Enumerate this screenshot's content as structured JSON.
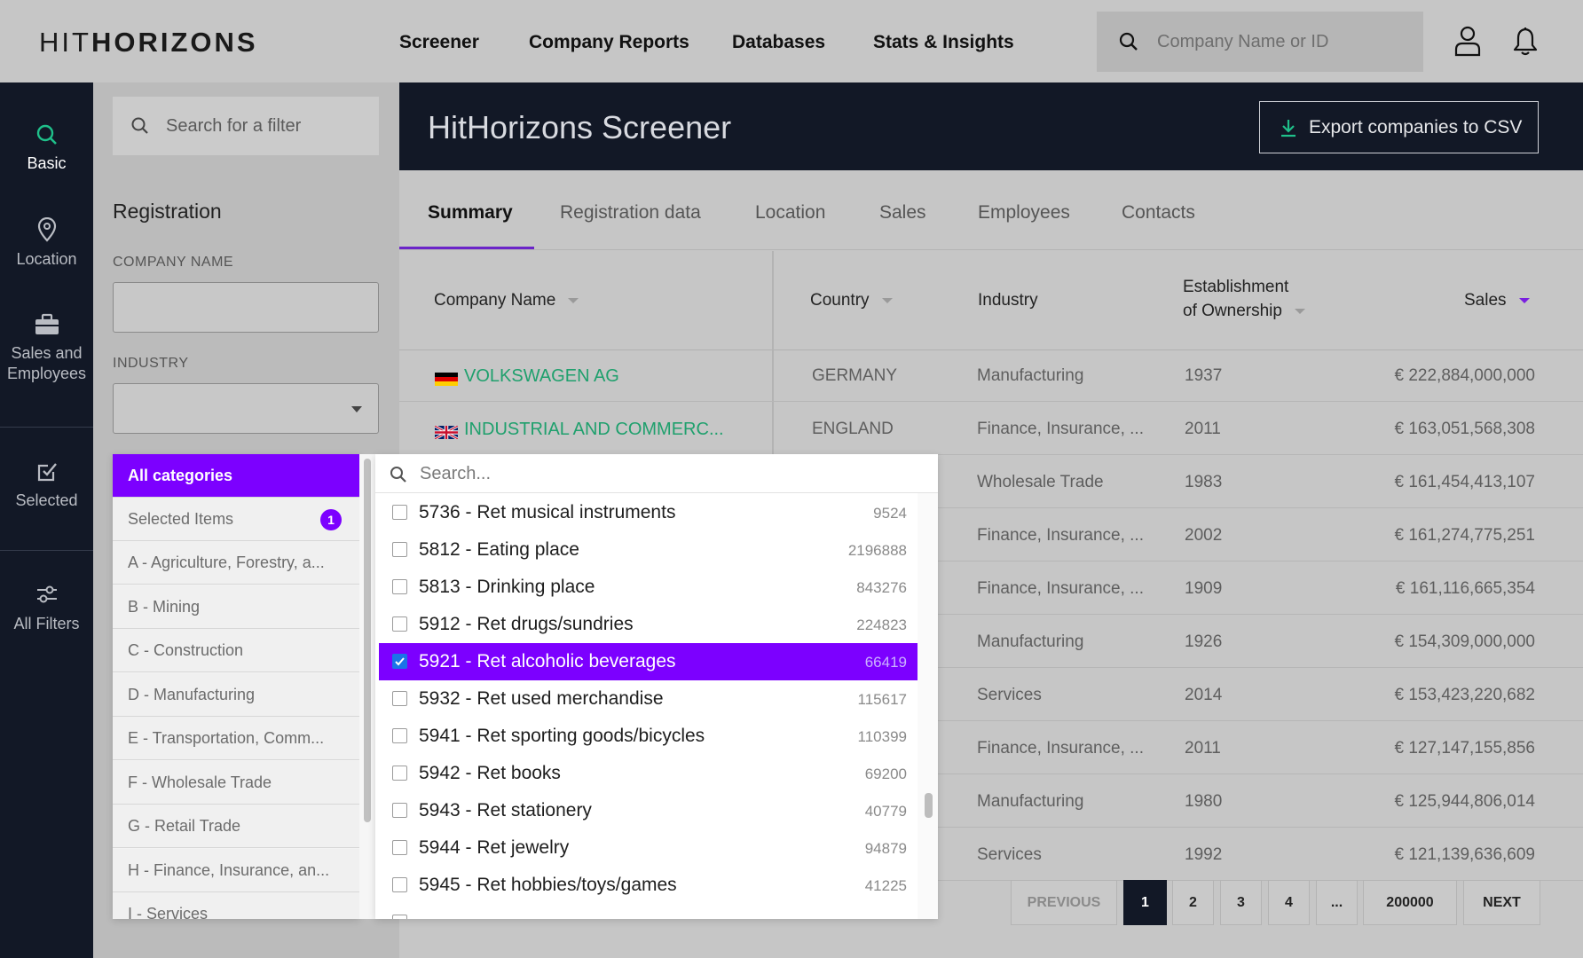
{
  "topbar": {
    "logo": {
      "part1": "HIT",
      "part2": "HORIZONS"
    },
    "nav": [
      "Screener",
      "Company Reports",
      "Databases",
      "Stats & Insights"
    ],
    "search_placeholder": "Company Name or ID",
    "icons": [
      "search-icon",
      "user-icon",
      "bell-icon"
    ]
  },
  "rail": {
    "items": [
      {
        "label": "Basic",
        "icon": "search-icon",
        "active": true
      },
      {
        "label": "Location",
        "icon": "map-pin-icon"
      },
      {
        "label_line1": "Sales and",
        "label_line2": "Employees",
        "icon": "briefcase-icon"
      },
      {
        "label": "Selected",
        "icon": "checkbox-icon"
      },
      {
        "label": "All Filters",
        "icon": "sliders-icon"
      }
    ]
  },
  "filter_panel": {
    "search_placeholder": "Search for a filter",
    "section_title": "Registration",
    "company_name_label": "COMPANY NAME",
    "company_name_value": "",
    "industry_label": "INDUSTRY",
    "industry_value": ""
  },
  "main": {
    "title": "HitHorizons Screener",
    "export_label": "Export companies to CSV",
    "tabs": [
      "Summary",
      "Registration data",
      "Location",
      "Sales",
      "Employees",
      "Contacts"
    ],
    "active_tab": "Summary"
  },
  "table": {
    "headers": {
      "company": "Company Name",
      "country": "Country",
      "industry": "Industry",
      "established_line1": "Establishment",
      "established_line2": "of Ownership",
      "sales": "Sales"
    },
    "rows": [
      {
        "name": "VOLKSWAGEN AG",
        "flag": "de",
        "country": "GERMANY",
        "industry": "Manufacturing",
        "year": "1937",
        "sales": "€ 222,884,000,000"
      },
      {
        "name": "INDUSTRIAL AND COMMERC...",
        "flag": "gb",
        "country": "ENGLAND",
        "industry": "Finance, Insurance, ...",
        "year": "2011",
        "sales": "€ 163,051,568,308"
      },
      {
        "name": "",
        "flag": "",
        "country": "",
        "industry": "Wholesale Trade",
        "year": "1983",
        "sales": "€ 161,454,413,107"
      },
      {
        "name": "",
        "flag": "",
        "country": "",
        "industry": "Finance, Insurance, ...",
        "year": "2002",
        "sales": "€ 161,274,775,251"
      },
      {
        "name": "",
        "flag": "",
        "country": "",
        "industry": "Finance, Insurance, ...",
        "year": "1909",
        "sales": "€ 161,116,665,354"
      },
      {
        "name": "",
        "flag": "",
        "country": "",
        "industry": "Manufacturing",
        "year": "1926",
        "sales": "€ 154,309,000,000"
      },
      {
        "name": "",
        "flag": "",
        "country": "",
        "industry": "Services",
        "year": "2014",
        "sales": "€ 153,423,220,682"
      },
      {
        "name": "",
        "flag": "",
        "country": "",
        "industry": "Finance, Insurance, ...",
        "year": "2011",
        "sales": "€ 127,147,155,856"
      },
      {
        "name": "",
        "flag": "",
        "country": "",
        "industry": "Manufacturing",
        "year": "1980",
        "sales": "€ 125,944,806,014"
      },
      {
        "name": "",
        "flag": "",
        "country": "",
        "industry": "Services",
        "year": "1992",
        "sales": "€ 121,139,636,609"
      }
    ]
  },
  "pagination": {
    "previous": "PREVIOUS",
    "pages": [
      "1",
      "2",
      "3",
      "4",
      "...",
      "200000"
    ],
    "current": "1",
    "next": "NEXT"
  },
  "dropdown": {
    "categories": [
      "All categories",
      "Selected Items",
      "A - Agriculture, Forestry, a...",
      "B - Mining",
      "C - Construction",
      "D - Manufacturing",
      "E - Transportation, Comm...",
      "F - Wholesale Trade",
      "G - Retail Trade",
      "H - Finance, Insurance, an...",
      "I - Services"
    ],
    "selected_count": "1",
    "search_placeholder": "Search...",
    "items": [
      {
        "label": "5736 - Ret musical instruments",
        "count": "9524",
        "checked": false
      },
      {
        "label": "5812 - Eating place",
        "count": "2196888",
        "checked": false
      },
      {
        "label": "5813 - Drinking place",
        "count": "843276",
        "checked": false
      },
      {
        "label": "5912 - Ret drugs/sundries",
        "count": "224823",
        "checked": false
      },
      {
        "label": "5921 - Ret alcoholic beverages",
        "count": "66419",
        "checked": true
      },
      {
        "label": "5932 - Ret used merchandise",
        "count": "115617",
        "checked": false
      },
      {
        "label": "5941 - Ret sporting goods/bicycles",
        "count": "110399",
        "checked": false
      },
      {
        "label": "5942 - Ret books",
        "count": "69200",
        "checked": false
      },
      {
        "label": "5943 - Ret stationery",
        "count": "40779",
        "checked": false
      },
      {
        "label": "5944 - Ret jewelry",
        "count": "94879",
        "checked": false
      },
      {
        "label": "5945 - Ret hobbies/toys/games",
        "count": "41225",
        "checked": false
      }
    ]
  },
  "colors": {
    "accent": "#7c00ff",
    "navy": "#121826",
    "link_green": "#1fa06d",
    "page_gray": "#c6c6c6"
  }
}
